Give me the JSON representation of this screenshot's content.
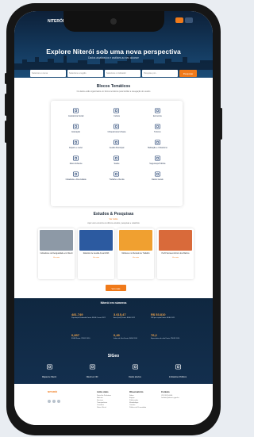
{
  "topbar": {
    "logo": "NITERÓI"
  },
  "hero": {
    "title": "Explore Niterói sob uma nova perspectiva",
    "subtitle": "Dados atualizados e análises ao seu alcance",
    "search_fields": [
      "Selecione o tema",
      "Selecione a região",
      "Selecione o indicador",
      "Pesquise por..."
    ],
    "search_button": "Pesquisar"
  },
  "blocos": {
    "title": "Blocos Temáticos",
    "subtitle": "Os dados estão organizados em blocos temáticos para facilitar a navegação do usuário",
    "items": [
      {
        "label": "Assistência Social",
        "icon": "hands-icon"
      },
      {
        "label": "Cultura",
        "icon": "theater-icon"
      },
      {
        "label": "Economia",
        "icon": "coins-icon"
      },
      {
        "label": "Educação",
        "icon": "book-icon"
      },
      {
        "label": "Infraestrutura Urbana",
        "icon": "buildings-icon"
      },
      {
        "label": "Turismo",
        "icon": "landmark-icon"
      },
      {
        "label": "Esporte e Lazer",
        "icon": "ball-icon"
      },
      {
        "label": "Gestão Municipal",
        "icon": "government-icon"
      },
      {
        "label": "Habitação e Urbanismo",
        "icon": "house-icon"
      },
      {
        "label": "Meio Ambiente",
        "icon": "leaf-icon"
      },
      {
        "label": "Saúde",
        "icon": "heart-icon"
      },
      {
        "label": "Segurança Pública",
        "icon": "shield-icon"
      },
      {
        "label": "Cidadania e Diversidade",
        "icon": "people-icon"
      },
      {
        "label": "Trabalho e Renda",
        "icon": "briefcase-icon"
      },
      {
        "label": "Dados Gerais",
        "icon": "chart-icon"
      }
    ]
  },
  "estudos": {
    "title": "Estudos & Pesquisas",
    "link": "Ver todos",
    "subtitle": "Aqui você encontra os últimos estudos, pesquisas e relatórios",
    "items": [
      {
        "title": "Indicadores de Desigualdade em Niterói",
        "meta": "Ver mais",
        "color": "#8d99a6"
      },
      {
        "title": "Relatório de Gestão Anual 2023",
        "meta": "Ver mais",
        "color": "#2c5aa0"
      },
      {
        "title": "Mulheres no Mercado de Trabalho",
        "meta": "Ver mais",
        "color": "#f0a030"
      },
      {
        "title": "Perfil Socioeconômico dos Bairros",
        "meta": "Ver mais",
        "color": "#d96a3a"
      }
    ],
    "button": "Ver mais"
  },
  "numbers": {
    "title": "Niterói em números",
    "stats": [
      {
        "value": "481.749",
        "label": "População Estimada Fonte: IBGE Censo 2022"
      },
      {
        "value": "3.615,47",
        "label": "Área (km²) Fonte: IBGE 2022"
      },
      {
        "value": "R$ 53.810",
        "label": "PIB per capita Fonte: IBGE 2021"
      },
      {
        "value": "0,837",
        "label": "IDHM Fonte: PNUD 2010"
      },
      {
        "value": "0,49",
        "label": "Índice de Gini Fonte: IBGE 2010"
      },
      {
        "value": "76,2",
        "label": "Expectativa de vida Fonte: PNUD 2010"
      }
    ],
    "brand": "SIGeo",
    "features": [
      {
        "label": "Mapas de Niterói",
        "icon": "map-icon"
      },
      {
        "label": "Niterói em 3D",
        "icon": "cube-icon"
      },
      {
        "label": "Dados abertos",
        "icon": "database-icon"
      },
      {
        "label": "Indicadores Públicos",
        "icon": "users-icon"
      }
    ]
  },
  "footer": {
    "logo": "NITERÓI",
    "columns": [
      {
        "heading": "Links úteis",
        "items": [
          "Portal da Prefeitura",
          "Notícias",
          "Serviços",
          "Transparência",
          "Ouvidoria",
          "Diário Oficial"
        ]
      },
      {
        "heading": "Observatório",
        "items": [
          "Sobre",
          "Equipe",
          "Publicações",
          "Metodologia",
          "Contato",
          "Política de Privacidade"
        ]
      },
      {
        "heading": "Contato",
        "items": [
          "(21) 2621-0000",
          "contato@niteroi.rj.gov.br"
        ]
      }
    ]
  },
  "colors": {
    "accent": "#f07a1a",
    "navy": "#13385c"
  }
}
